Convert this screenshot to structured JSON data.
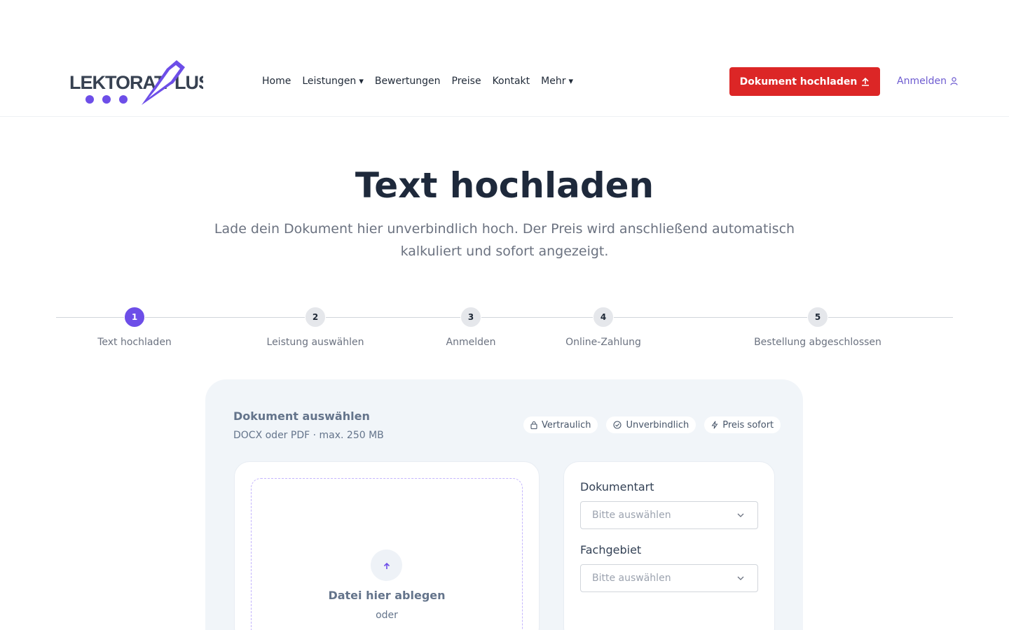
{
  "brand": {
    "logo_text": "LEKTORAT PLUS",
    "primary_color": "#6d4ee8",
    "cta_color": "#dc2626"
  },
  "nav": {
    "items": [
      {
        "label": "Home",
        "has_dropdown": false
      },
      {
        "label": "Leistungen",
        "has_dropdown": true
      },
      {
        "label": "Bewertungen",
        "has_dropdown": false
      },
      {
        "label": "Preise",
        "has_dropdown": false
      },
      {
        "label": "Kontakt",
        "has_dropdown": false
      },
      {
        "label": "Mehr",
        "has_dropdown": true
      }
    ],
    "cta_label": "Dokument hochladen",
    "login_label": "Anmelden"
  },
  "hero": {
    "title": "Text hochladen",
    "subtitle": "Lade dein Dokument hier unverbindlich hoch. Der Preis wird anschließend automatisch kalkuliert und sofort angezeigt."
  },
  "steps": [
    {
      "number": "1",
      "label": "Text hochladen",
      "active": true
    },
    {
      "number": "2",
      "label": "Leistung auswählen",
      "active": false
    },
    {
      "number": "3",
      "label": "Anmelden",
      "active": false
    },
    {
      "number": "4",
      "label": "Online-Zahlung",
      "active": false
    },
    {
      "number": "5",
      "label": "Bestellung abgeschlossen",
      "active": false
    }
  ],
  "upload": {
    "title": "Dokument auswählen",
    "subtitle": "DOCX oder PDF · max. 250 MB",
    "chips": [
      "Vertraulich",
      "Unverbindlich",
      "Preis sofort"
    ],
    "drop_text": "Datei hier ablegen",
    "drop_or": "oder"
  },
  "form": {
    "document_type_label": "Dokumentart",
    "document_type_placeholder": "Bitte auswählen",
    "subject_label": "Fachgebiet",
    "subject_placeholder": "Bitte auswählen"
  }
}
